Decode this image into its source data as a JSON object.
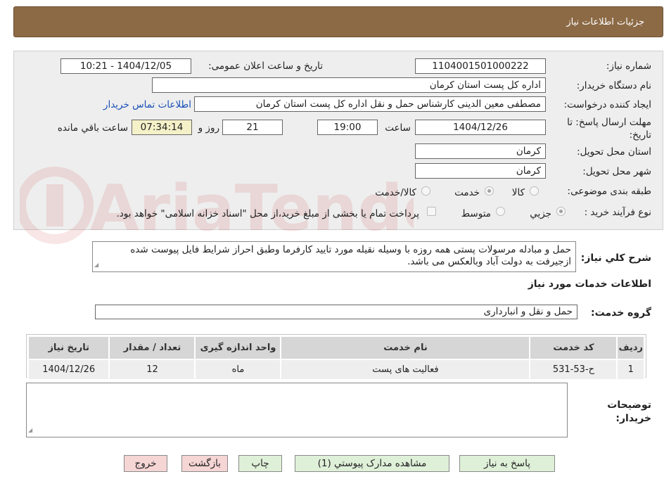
{
  "header": {
    "title": "جزئیات اطلاعات نیاز"
  },
  "form": {
    "need_number_label": "شماره نیاز:",
    "need_number": "1104001501000222",
    "announce_label": "تاریخ و ساعت اعلان عمومی:",
    "announce_value": "1404/12/05 - 10:21",
    "buyer_org_label": "نام دستگاه خریدار:",
    "buyer_org": "اداره کل پست استان کرمان",
    "creator_label": "ایجاد کننده درخواست:",
    "creator": "مصطفی معین الدینی کارشناس حمل و نقل اداره کل پست استان کرمان",
    "buyer_contact_link": "اطلاعات تماس خریدار",
    "deadline_label": "مهلت ارسال پاسخ: تا تاریخ:",
    "deadline_date": "1404/12/26",
    "time_label": "ساعت",
    "deadline_time": "19:00",
    "days": "21",
    "days_label": "روز و",
    "remaining_time": "07:34:14",
    "remaining_label": "ساعت باقي مانده",
    "province_label": "استان محل تحویل:",
    "province": "کرمان",
    "city_label": "شهر محل تحویل:",
    "city": "کرمان",
    "category_label": "طبقه بندی موضوعی:",
    "category_options": [
      "کالا",
      "خدمت",
      "کالا/خدمت"
    ],
    "category_selected": "خدمت",
    "process_label": "نوع فرآیند خرید :",
    "process_options": [
      "جزیي",
      "متوسط"
    ],
    "process_selected": "جزیي",
    "payment_note": "پرداخت تمام یا بخشی از مبلغ خرید،از محل \"اسناد خزانه اسلامی\" خواهد بود."
  },
  "description": {
    "label": "شرح کلي نیاز:",
    "text": "حمل و مبادله مرسولات پستی همه روزه با وسیله نقیله مورد تایید کارفرما وطبق احراز شرایط فایل پیوست شده ازجیرفت به دولت آباد وبالعکس می باشد."
  },
  "services": {
    "section_title": "اطلاعات خدمات مورد نیاز",
    "group_label": "گروه خدمت:",
    "group_value": "حمل و نقل و انبارداری",
    "columns": [
      "ردیف",
      "کد خدمت",
      "نام خدمت",
      "واحد اندازه گیری",
      "تعداد / مقدار",
      "تاریخ نیاز"
    ],
    "rows": [
      [
        "1",
        "ح-53-531",
        "فعالیت های پست",
        "ماه",
        "12",
        "1404/12/26"
      ]
    ]
  },
  "buyer_notes": {
    "label_line1": "توضیحات",
    "label_line2": "خریدار:",
    "value": ""
  },
  "buttons": {
    "reply": "پاسخ به نیاز",
    "view_docs": "مشاهده مدارک پیوستي (1)",
    "print": "چاپ",
    "back": "بازگشت",
    "exit": "خروج"
  },
  "colors": {
    "header_bg": "#8c6a45",
    "button_green": "#dff0d8",
    "button_red": "#f6d5d5",
    "link": "#1a4fb5"
  }
}
